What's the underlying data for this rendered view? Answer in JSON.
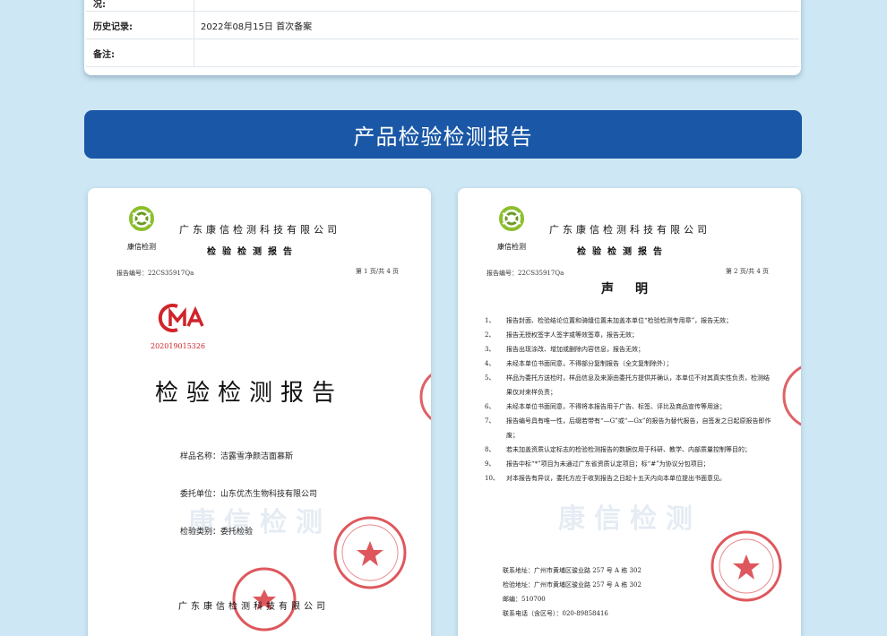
{
  "info_table": {
    "rows": [
      {
        "key": "况:",
        "value": ""
      },
      {
        "key": "历史记录:",
        "value": "2022年08月15日 首次备案"
      },
      {
        "key": "备注:",
        "value": ""
      }
    ]
  },
  "banner": {
    "title": "产品检验检测报告"
  },
  "doc1": {
    "logo_text": "康信检测",
    "company": "广东康信检测科技有限公司",
    "subtitle": "检验检测报告",
    "report_no": "报告编号：22CS35917Qa",
    "page_no": "第 1 页/共 4 页",
    "cma_number": "202019015326",
    "title": "检验检测报告",
    "fields": [
      "样品名称：洁露雪净颜洁面慕斯",
      "委托单位：山东优杰生物科技有限公司",
      "检验类别：委托检验"
    ],
    "footer_company": "广东康信检测科技有限公司",
    "watermark": "康信检测"
  },
  "doc2": {
    "logo_text": "康信检测",
    "company": "广东康信检测科技有限公司",
    "subtitle": "检验检测报告",
    "report_no": "报告编号：22CS35917Qa",
    "page_no": "第 2 页/共 4 页",
    "declaration_title": "声明",
    "items": [
      {
        "n": "1、",
        "t": "报告封面、检验结论位置和骑缝位置未加盖本单位“检验检测专用章”，报告无效；"
      },
      {
        "n": "2、",
        "t": "报告无授权签字人签字或等效签章，报告无效；"
      },
      {
        "n": "3、",
        "t": "报告出现涂改、增加或删除内容信息，报告无效；"
      },
      {
        "n": "4、",
        "t": "未经本单位书面同意，不得部分复制报告（全文复制除外）；"
      },
      {
        "n": "5、",
        "t": "样品为委托方送检时，样品信息及来源由委托方提供并确认，本单位不对其真实性负责，检测结果仅对来样负责；"
      },
      {
        "n": "6、",
        "t": "未经本单位书面同意，不得将本报告用于广告、标签、评比及商品宣传等用途；"
      },
      {
        "n": "7、",
        "t": "报告编号具有唯一性，后缀若带有“—G”或“—Gx”的报告为替代报告，自签发之日起原报告即作废；"
      },
      {
        "n": "8、",
        "t": "若未加盖资质认定标志的检验检测报告的数据仅用于科研、教学、内部质量控制等目的；"
      },
      {
        "n": "9、",
        "t": "报告中标“*”项目为未通过广东省资质认定项目；标“#”为协议分包项目；"
      },
      {
        "n": "10、",
        "t": "对本报告有异议，委托方应于收到报告之日起十五天内向本单位提出书面意见。"
      }
    ],
    "contacts": [
      "联系地址：广州市黄埔区骏业路 257 号 A 栋 302",
      "检验地址：广州市黄埔区骏业路 257 号 A 栋 302",
      "邮编：510700",
      "联系电话（含区号）：020-89858416"
    ],
    "watermark": "康信检测"
  },
  "colors": {
    "banner": "#1a57a6",
    "seal": "#d0242a",
    "background": "#cde7f4"
  }
}
